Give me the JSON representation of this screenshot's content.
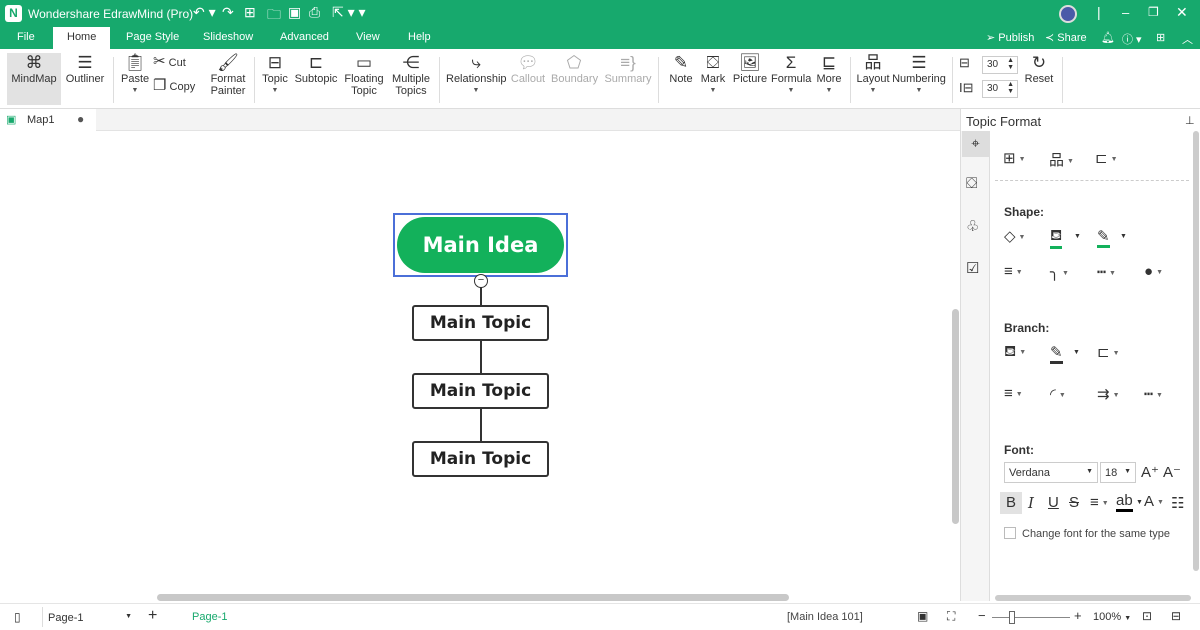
{
  "app": {
    "title": "Wondershare EdrawMind (Pro)",
    "accent": "#17a96d",
    "node_color": "#13b15b"
  },
  "titlebar": {
    "quick": [
      "undo-icon",
      "redo-icon",
      "new-icon",
      "open-icon",
      "save-icon",
      "print-icon",
      "export-icon"
    ],
    "window": [
      "minimize",
      "restore",
      "close"
    ]
  },
  "menus": [
    "File",
    "Home",
    "Page Style",
    "Slideshow",
    "Advanced",
    "View",
    "Help"
  ],
  "right_menu": {
    "publish": "Publish",
    "share": "Share"
  },
  "ribbon": {
    "mindmap": "MindMap",
    "outliner": "Outliner",
    "paste": "Paste",
    "cut": "Cut",
    "copy": "Copy",
    "format_painter_1": "Format",
    "format_painter_2": "Painter",
    "topic": "Topic",
    "subtopic": "Subtopic",
    "floating_1": "Floating",
    "floating_2": "Topic",
    "multiple_1": "Multiple",
    "multiple_2": "Topics",
    "relationship": "Relationship",
    "callout": "Callout",
    "boundary": "Boundary",
    "summary": "Summary",
    "note": "Note",
    "mark": "Mark",
    "picture": "Picture",
    "formula": "Formula",
    "more": "More",
    "layout": "Layout",
    "numbering": "Numbering",
    "h_spacing": "30",
    "v_spacing": "30",
    "reset": "Reset"
  },
  "doc_tab": {
    "name": "Map1"
  },
  "map": {
    "root": "Main Idea",
    "topics": [
      "Main Topic",
      "Main Topic",
      "Main Topic"
    ]
  },
  "panel": {
    "title": "Topic Format",
    "shape_label": "Shape:",
    "branch_label": "Branch:",
    "font_label": "Font:",
    "font": "Verdana",
    "size": "18",
    "checkbox": "Change font for the same type",
    "checkbox_checked": false,
    "bold_active": true
  },
  "status": {
    "page_select": "Page-1",
    "page_tab": "Page-1",
    "selection": "[Main Idea 101]",
    "zoom": "100%",
    "zoom_level": 100
  }
}
